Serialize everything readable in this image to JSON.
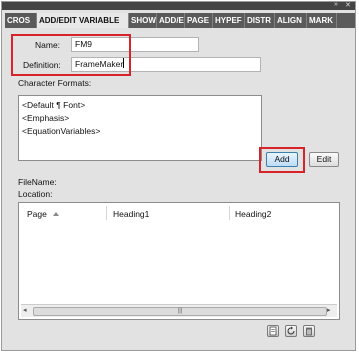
{
  "window": {
    "collapse_glyph": "»",
    "close_glyph": "✕"
  },
  "tabs": [
    {
      "label": "CROS",
      "active": false
    },
    {
      "label": "ADD/EDIT VARIABLE",
      "active": true
    },
    {
      "label": "SHOW",
      "active": false
    },
    {
      "label": "ADD/E",
      "active": false
    },
    {
      "label": "PAGE",
      "active": false
    },
    {
      "label": "HYPEF",
      "active": false
    },
    {
      "label": "DISTR",
      "active": false
    },
    {
      "label": "ALIGN",
      "active": false
    },
    {
      "label": "MARK",
      "active": false
    }
  ],
  "form": {
    "name_label": "Name:",
    "name_value": "FM9",
    "definition_label": "Definition:",
    "definition_value": "FrameMaker",
    "char_formats_label": "Character Formats:",
    "char_formats": [
      "<Default ¶ Font>",
      "<Emphasis>",
      "<EquationVariables>"
    ],
    "add_label": "Add",
    "edit_label": "Edit",
    "filename_label": "FileName:",
    "location_label": "Location:"
  },
  "table": {
    "columns": [
      "Page",
      "Heading1",
      "Heading2"
    ],
    "sort_column": "Page",
    "rows": []
  },
  "scrollbar": {
    "left_arrow": "◂",
    "right_arrow": "▸",
    "thumb_grip": "|||"
  },
  "bottom_icons": [
    "document-icon",
    "refresh-icon",
    "delete-icon"
  ],
  "colors": {
    "highlight_border": "#d8232a",
    "panel_bg": "#e2e2e2",
    "tab_bar": "#5a5a5a",
    "add_button": "#bddcf6"
  }
}
